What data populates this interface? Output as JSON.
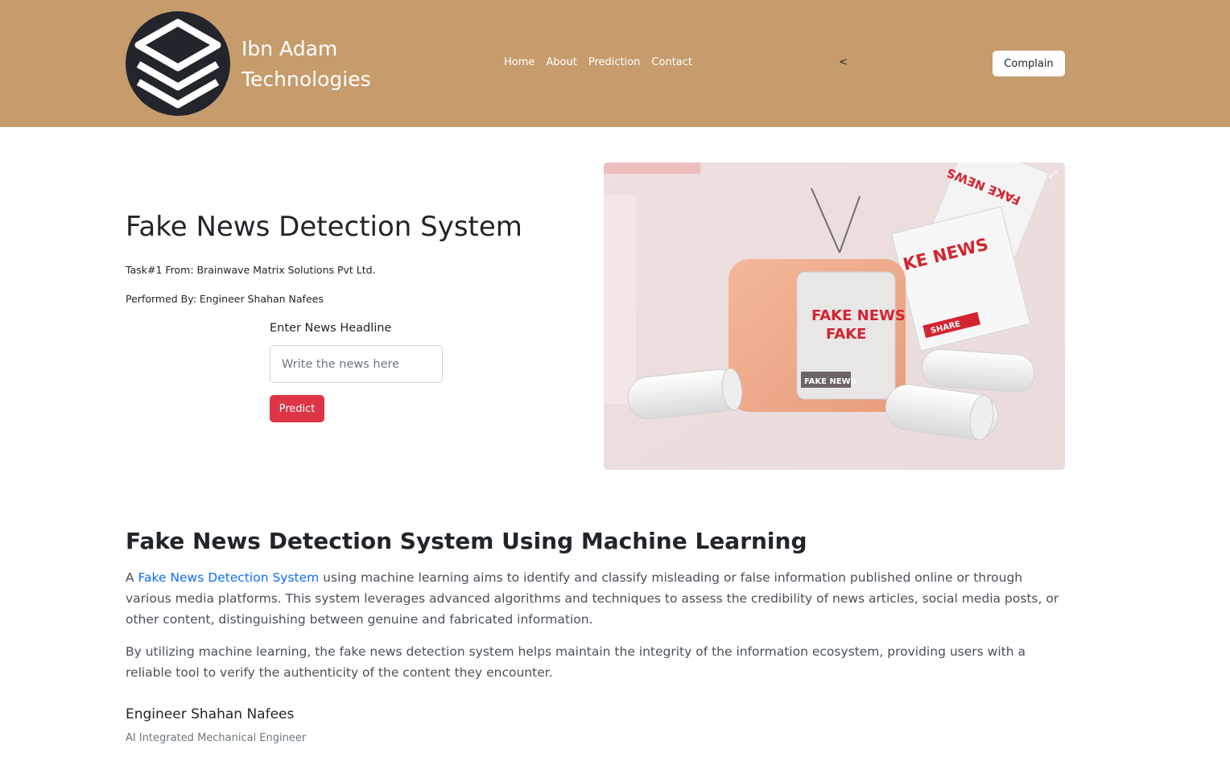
{
  "brand": {
    "line1": "Ibn Adam",
    "line2": "Technologies"
  },
  "nav": {
    "items": [
      "Home",
      "About",
      "Prediction",
      "Contact"
    ],
    "chevron": "<"
  },
  "header": {
    "complain_label": "Complain"
  },
  "hero": {
    "title": "Fake News Detection System",
    "task": "Task#1 From: Brainwave Matrix Solutions Pvt Ltd.",
    "performed_by": "Performed By: Engineer Shahan Nafees",
    "input_label": "Enter News Headline",
    "input_placeholder": "Write the news here",
    "predict_label": "Predict",
    "image": {
      "tv_screen_text_1": "FAKE NEWS",
      "tv_screen_text_2": "FAKE",
      "tv_badge": "FAKE NEWS",
      "newspaper_text": "KE NEWS",
      "share_label": "SHARE",
      "top_paper_text": "FAKE NEWS",
      "expand_icon": "expand-icon"
    }
  },
  "about": {
    "title": "Fake News Detection System Using Machine Learning",
    "p1_prefix": "A ",
    "p1_link": "Fake News Detection System",
    "p1_rest": " using machine learning aims to identify and classify misleading or false information published online or through various media platforms. This system leverages advanced algorithms and techniques to assess the credibility of news articles, social media posts, or other content, distinguishing between genuine and fabricated information.",
    "p2": "By utilizing machine learning, the fake news detection system helps maintain the integrity of the information ecosystem, providing users with a reliable tool to verify the authenticity of the content they encounter."
  },
  "author": {
    "name": "Engineer Shahan Nafees",
    "role": "AI Integrated Mechanical Engineer"
  },
  "colors": {
    "header_bg": "#c69c6d",
    "predict_bg": "#dc3545",
    "link": "#0d6efd",
    "logo_bg": "#22252b"
  }
}
